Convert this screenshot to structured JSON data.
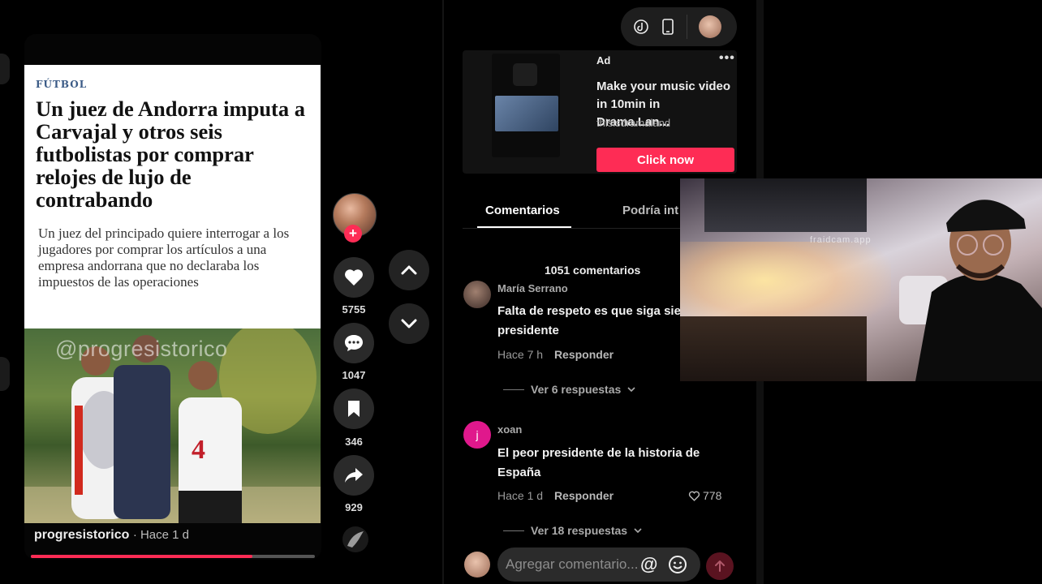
{
  "video": {
    "article": {
      "category": "FÚTBOL",
      "title": "Un juez de Andorra imputa a Carvajal y otros seis futbolistas por comprar relojes de lujo de contrabando",
      "subtitle": "Un juez del principado quiere interrogar a los jugadores por comprar los artículos a una empresa andorrana que no declaraba los impuestos de las operaciones"
    },
    "watermark": "@progresistorico",
    "author": "progresistorico",
    "time": "· Hace 1 d",
    "progress": 0.78
  },
  "rail": {
    "likes": "5755",
    "comments": "1047",
    "saves": "346",
    "shares": "929"
  },
  "ad": {
    "label": "Ad",
    "more": "•••",
    "title": "Make your music video in 10min in Drama.Lan...",
    "handle": "thisisdramaland",
    "cta": "Click now"
  },
  "tabs": [
    {
      "label": "Comentarios",
      "active": true
    },
    {
      "label": "Podría int",
      "active": false
    }
  ],
  "comments": {
    "count": "1051 comentarios",
    "items": [
      {
        "user": "María Serrano",
        "text": "Falta de respeto es que siga sie presidente",
        "time": "Hace 7 h",
        "reply": "Responder",
        "replies": "Ver 6 respuestas",
        "likes": ""
      },
      {
        "user": "xoan",
        "initial": "j",
        "text": "El peor presidente de la historia de España",
        "time": "Hace 1 d",
        "reply": "Responder",
        "replies": "Ver 18 respuestas",
        "likes": "778"
      }
    ]
  },
  "composer": {
    "placeholder": "Agregar comentario..."
  },
  "webcam": {
    "watermark": "fraidcam.app"
  },
  "colors": {
    "accent": "#fe2c55",
    "background": "#000000"
  }
}
